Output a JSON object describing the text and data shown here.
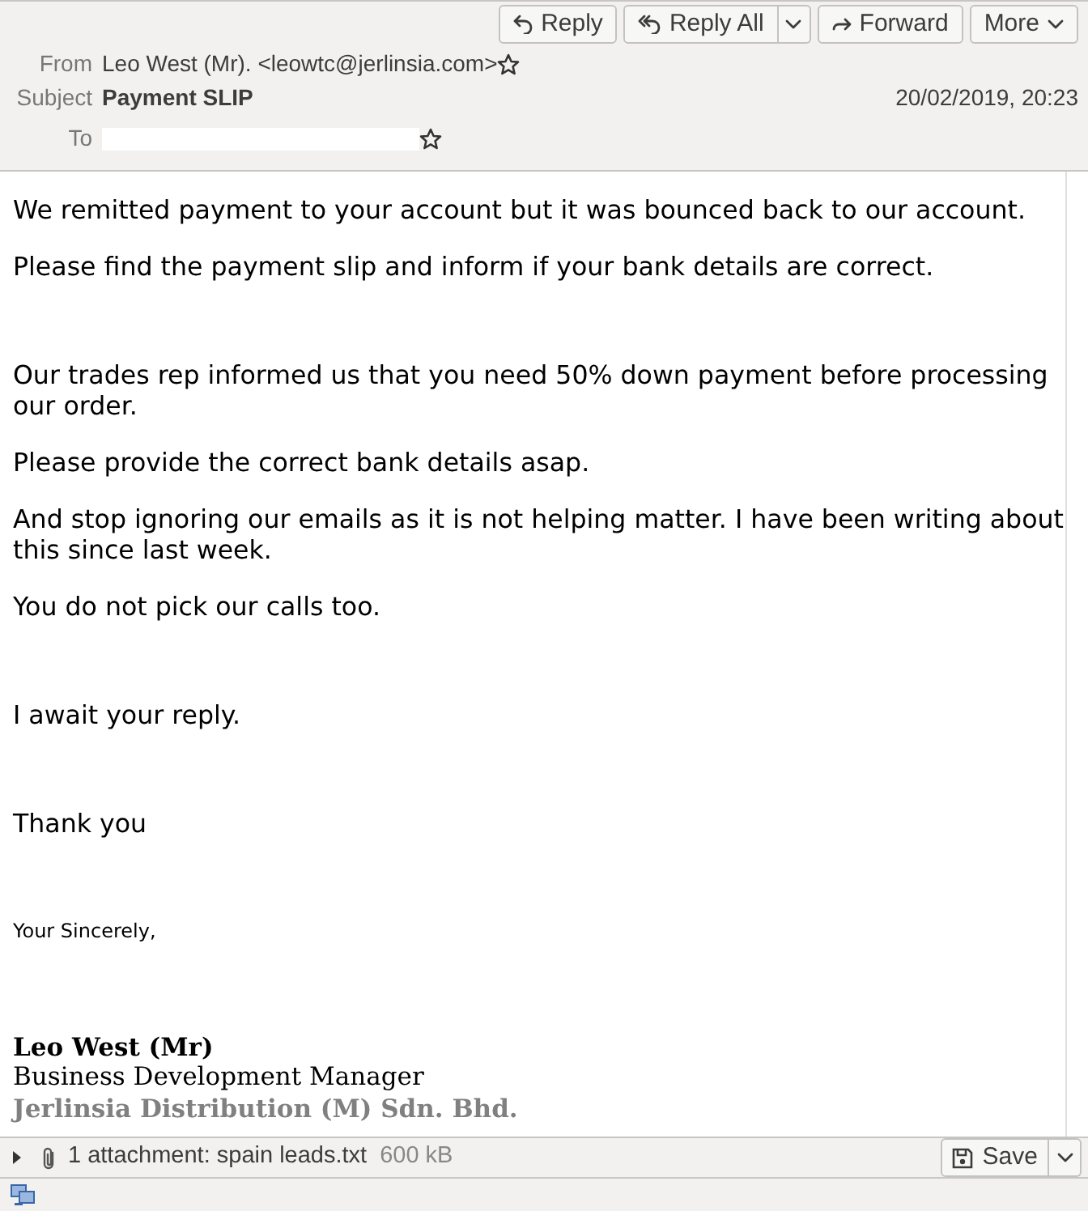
{
  "toolbar": {
    "buttons": [
      {
        "label": "Reply",
        "dropdown": false
      },
      {
        "label": "Reply All",
        "dropdown": true
      },
      {
        "label": "Forward",
        "dropdown": false
      },
      {
        "label": "More",
        "dropdown": true
      }
    ]
  },
  "header": {
    "from_label": "From",
    "from": "Leo West (Mr). <leowtc@jerlinsia.com>",
    "subject_label": "Subject",
    "subject": "Payment SLIP",
    "date": "20/02/2019, 20:23",
    "to_label": "To"
  },
  "body": [
    {
      "kind": "paragraph",
      "text": "We remitted payment to your account but it was bounced back to our account."
    },
    {
      "kind": "paragraph",
      "text": "Please find the payment slip and inform if your bank details are correct."
    },
    {
      "kind": "blank"
    },
    {
      "kind": "paragraph",
      "text": "Our trades rep informed us that you need 50% down payment before processing our order."
    },
    {
      "kind": "paragraph",
      "text": "Please provide the correct bank details asap."
    },
    {
      "kind": "paragraph",
      "text": "And stop ignoring our emails as it is not helping matter. I have been writing about this since last week."
    },
    {
      "kind": "paragraph",
      "text": "You do not pick our calls too."
    },
    {
      "kind": "blank"
    },
    {
      "kind": "paragraph",
      "text": "I await your reply."
    },
    {
      "kind": "blank"
    },
    {
      "kind": "paragraph",
      "text": "Thank you"
    },
    {
      "kind": "blank"
    },
    {
      "kind": "small",
      "text": "Your Sincerely,"
    }
  ],
  "signature": {
    "name": "Leo West (Mr)",
    "title": "Business Development Manager",
    "company": "Jerlinsia Distribution (M) Sdn. Bhd."
  },
  "attachment_bar": {
    "summary": "1 attachment: spain leads.txt",
    "size": "600 kB",
    "expanded": false,
    "save_label": "Save"
  }
}
